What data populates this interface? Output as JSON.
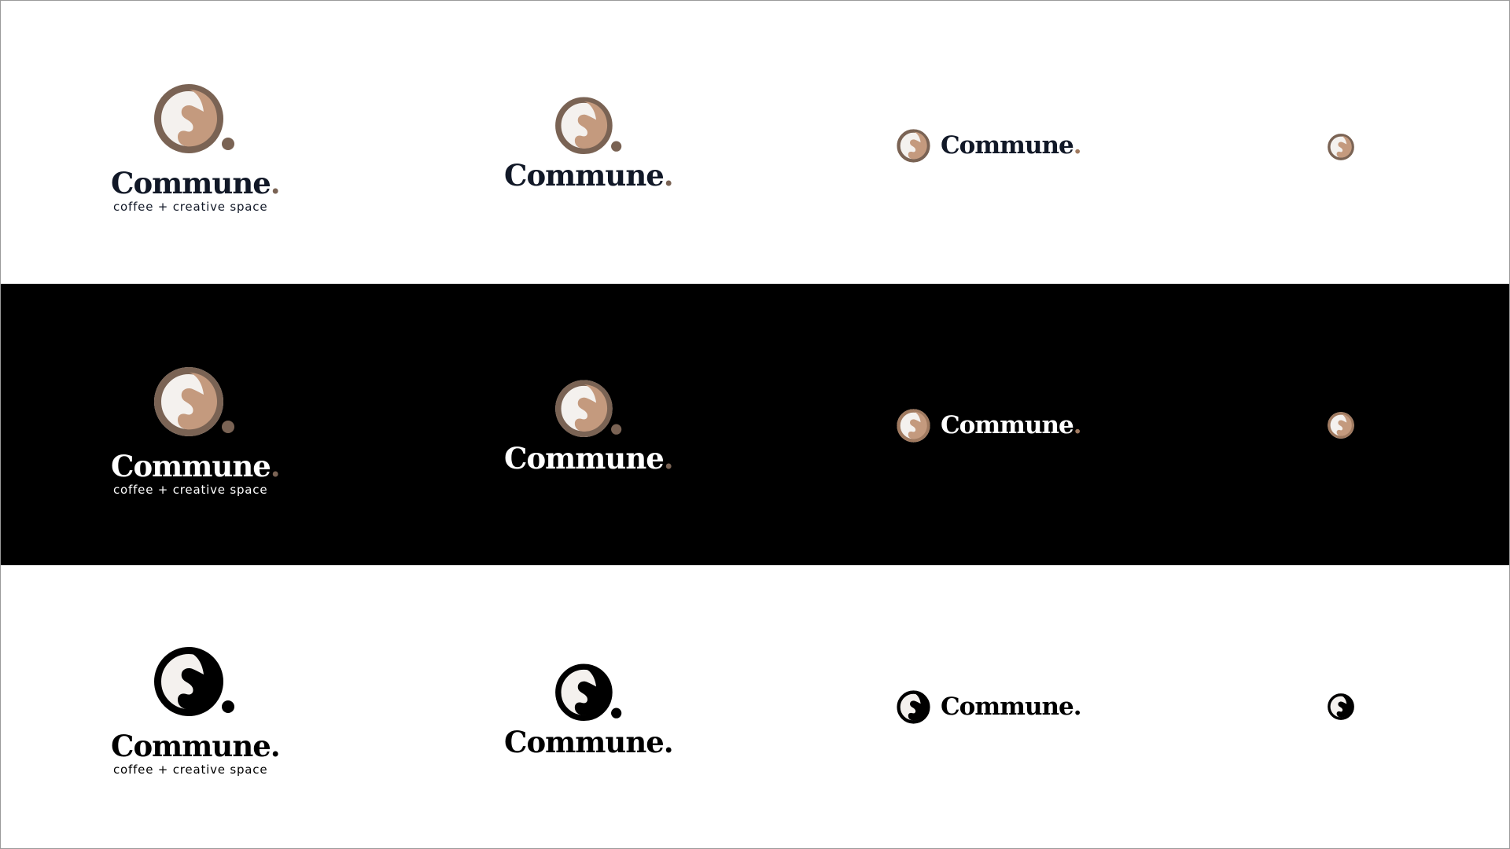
{
  "brand": {
    "name": "Commune",
    "dot": ".",
    "tagline": "coffee + creative space"
  },
  "colors": {
    "dark_band": "#000000",
    "ring": "#7a6354",
    "fill": "#c49a7e",
    "light": "#f4f1ee",
    "mono": "#000000"
  },
  "rows": [
    {
      "variant": "color-on-light"
    },
    {
      "variant": "color-on-dark"
    },
    {
      "variant": "mono-black"
    }
  ],
  "columns": [
    "full-lockup",
    "stacked",
    "horizontal",
    "icon-only"
  ],
  "icon": "coffee-cup-c-icon"
}
